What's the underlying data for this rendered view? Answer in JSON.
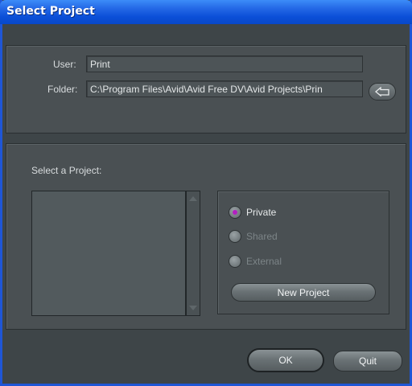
{
  "window": {
    "title": "Select Project"
  },
  "user": {
    "label": "User:",
    "value": "Print"
  },
  "folder": {
    "label": "Folder:",
    "value": "C:\\Program Files\\Avid\\Avid Free DV\\Avid Projects\\Prin",
    "button_icon": "folder-browse-icon"
  },
  "projects": {
    "label": "Select a Project:",
    "items": []
  },
  "location": {
    "options": [
      {
        "label": "Private",
        "selected": true,
        "enabled": true
      },
      {
        "label": "Shared",
        "selected": false,
        "enabled": false
      },
      {
        "label": "External",
        "selected": false,
        "enabled": false
      }
    ],
    "new_project_label": "New Project"
  },
  "buttons": {
    "ok": "OK",
    "quit": "Quit"
  },
  "colors": {
    "titlebar": "#0b4fd8",
    "panel": "#4a5053",
    "radio_selected": "#b41fc2"
  }
}
